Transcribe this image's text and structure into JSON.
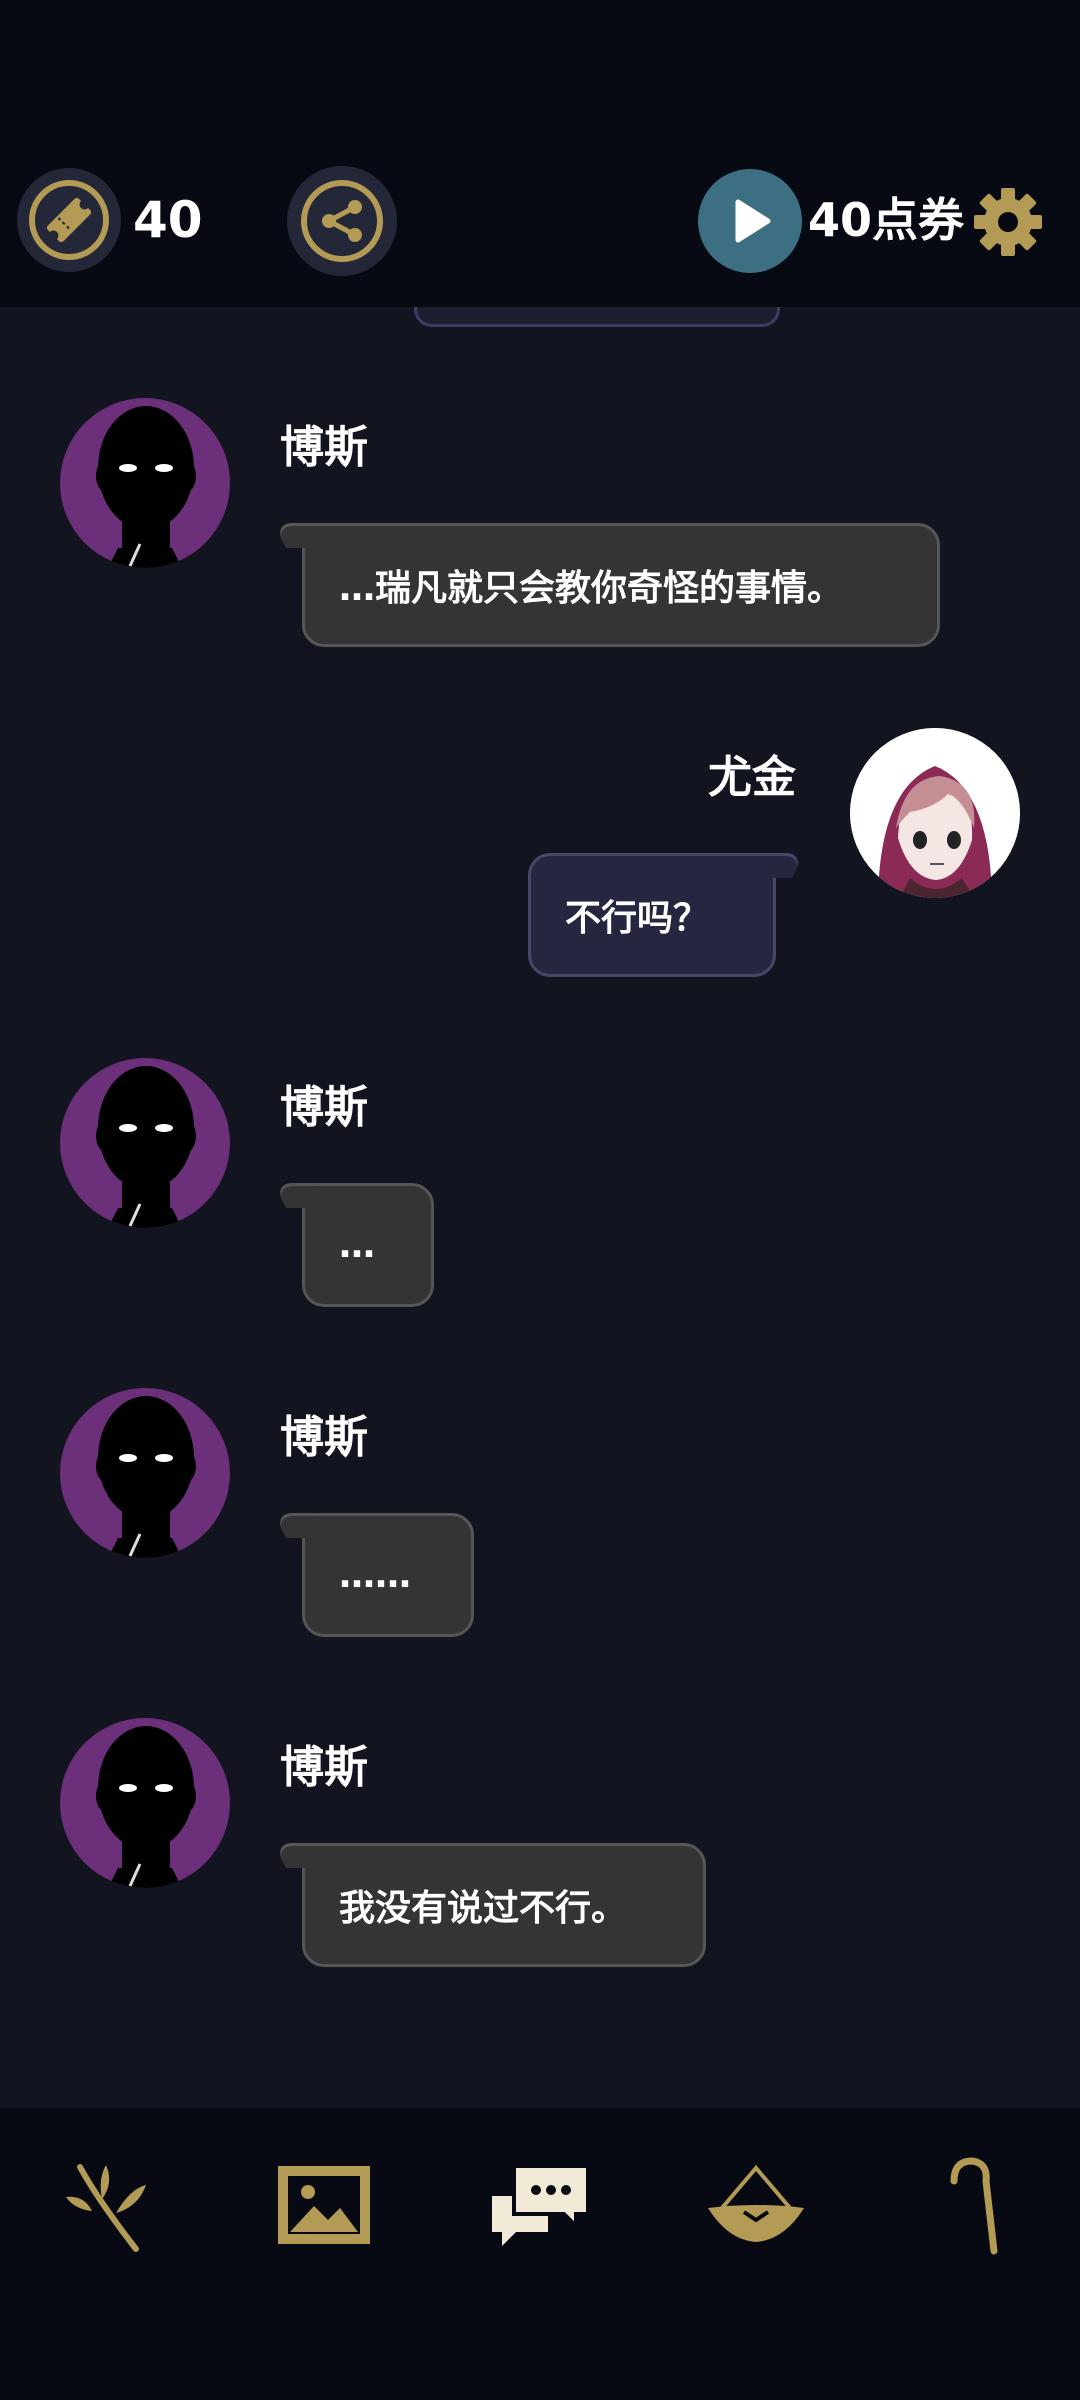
{
  "header": {
    "ticket_count": "40",
    "points_label": "40点券"
  },
  "chat": {
    "messages": [
      {
        "speaker": "博斯",
        "text": "…瑞凡就只会教你奇怪的事情。",
        "side": "left"
      },
      {
        "speaker": "尤金",
        "text": "不行吗？",
        "side": "right"
      },
      {
        "speaker": "博斯",
        "text": "…",
        "side": "left"
      },
      {
        "speaker": "博斯",
        "text": "……",
        "side": "left"
      },
      {
        "speaker": "博斯",
        "text": "我没有说过不行。",
        "side": "left"
      }
    ]
  },
  "nav": {
    "items": [
      "branch-icon",
      "gallery-icon",
      "chat-icon",
      "hat-icon",
      "cane-icon"
    ],
    "active_index": 2
  },
  "colors": {
    "background": "#121420",
    "bar": "#070a12",
    "gold": "#b39a55",
    "avatar_purple": "#6c2f79",
    "play_teal": "#3d6f82"
  }
}
